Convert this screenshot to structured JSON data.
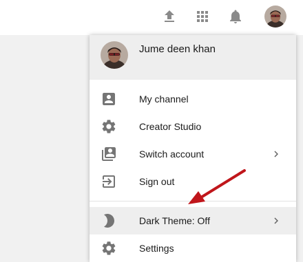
{
  "topbar": {
    "icons": [
      "upload-icon",
      "apps-grid-icon",
      "notifications-bell-icon"
    ],
    "avatar": "account-avatar"
  },
  "menu": {
    "user_name": "Jume deen khan",
    "items": [
      {
        "label": "My channel",
        "icon": "account-box-icon"
      },
      {
        "label": "Creator Studio",
        "icon": "gear-icon"
      },
      {
        "label": "Switch account",
        "icon": "switch-account-icon"
      },
      {
        "label": "Sign out",
        "icon": "sign-out-icon"
      }
    ],
    "theme_item": {
      "label": "Dark Theme: Off",
      "icon": "moon-icon"
    },
    "settings_item": {
      "label": "Settings",
      "icon": "gear-icon"
    }
  },
  "annotation": {
    "arrow_color": "#c0161b"
  },
  "colors": {
    "icon_gray": "#757575",
    "hover_bg": "#eeeeee",
    "header_bg": "#eeeeee"
  }
}
